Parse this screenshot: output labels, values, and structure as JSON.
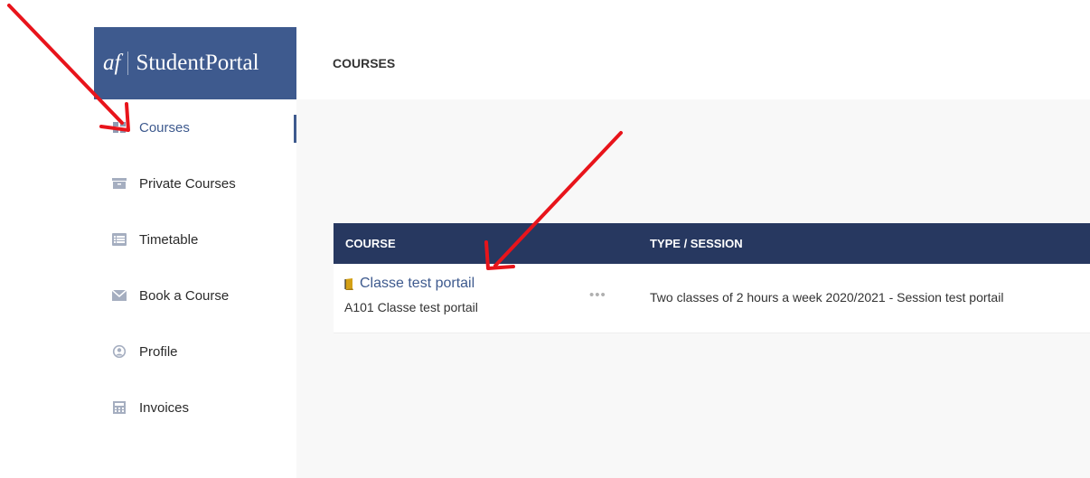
{
  "brand": {
    "logo": "af",
    "name": "StudentPortal"
  },
  "sidebar": {
    "items": [
      {
        "label": "Courses",
        "icon": "grid-icon",
        "active": true
      },
      {
        "label": "Private Courses",
        "icon": "archive-icon"
      },
      {
        "label": "Timetable",
        "icon": "list-icon"
      },
      {
        "label": "Book a Course",
        "icon": "envelope-icon"
      },
      {
        "label": "Profile",
        "icon": "user-icon"
      },
      {
        "label": "Invoices",
        "icon": "calculator-icon"
      }
    ]
  },
  "header": {
    "title": "COURSES"
  },
  "table": {
    "columns": [
      "COURSE",
      "TYPE / SESSION"
    ],
    "rows": [
      {
        "title": "Classe test portail",
        "code": "A101 Classe test portail",
        "more": "•••",
        "session": "Two classes of 2 hours a week 2020/2021 - Session test portail"
      }
    ]
  },
  "colors": {
    "brand": "#3e5a8e",
    "table_header": "#273860",
    "annotation": "#e8141b",
    "book_icon": "#d4a015"
  }
}
